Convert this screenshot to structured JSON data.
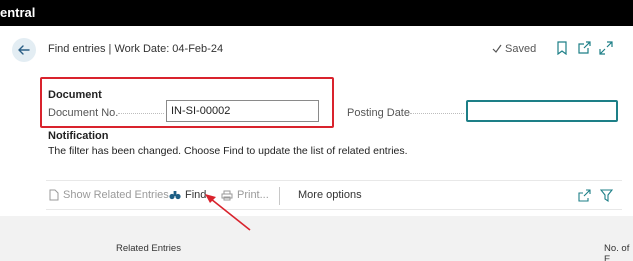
{
  "app": {
    "title": "entral"
  },
  "header": {
    "page_title": "Find entries | Work Date: 04-Feb-24",
    "saved_label": "Saved",
    "icons": [
      "back-arrow-icon",
      "bookmark-icon",
      "open-in-new-window-icon",
      "expand-icon"
    ]
  },
  "document": {
    "group_title": "Document",
    "document_no_label": "Document No.",
    "document_no_value": "IN-SI-00002",
    "posting_date_label": "Posting Date",
    "posting_date_value": ""
  },
  "notification": {
    "title": "Notification",
    "text": "The filter has been changed. Choose Find to update the list of related entries."
  },
  "actions": {
    "show_related": "Show Related Entries",
    "find": "Find",
    "print": "Print...",
    "more_options": "More options"
  },
  "list": {
    "col_related_entries": "Related Entries",
    "col_no_of_entries": "No. of E"
  },
  "colors": {
    "highlight": "#d9232d",
    "focus": "#1d7f87",
    "arrow": "#d9232d"
  }
}
